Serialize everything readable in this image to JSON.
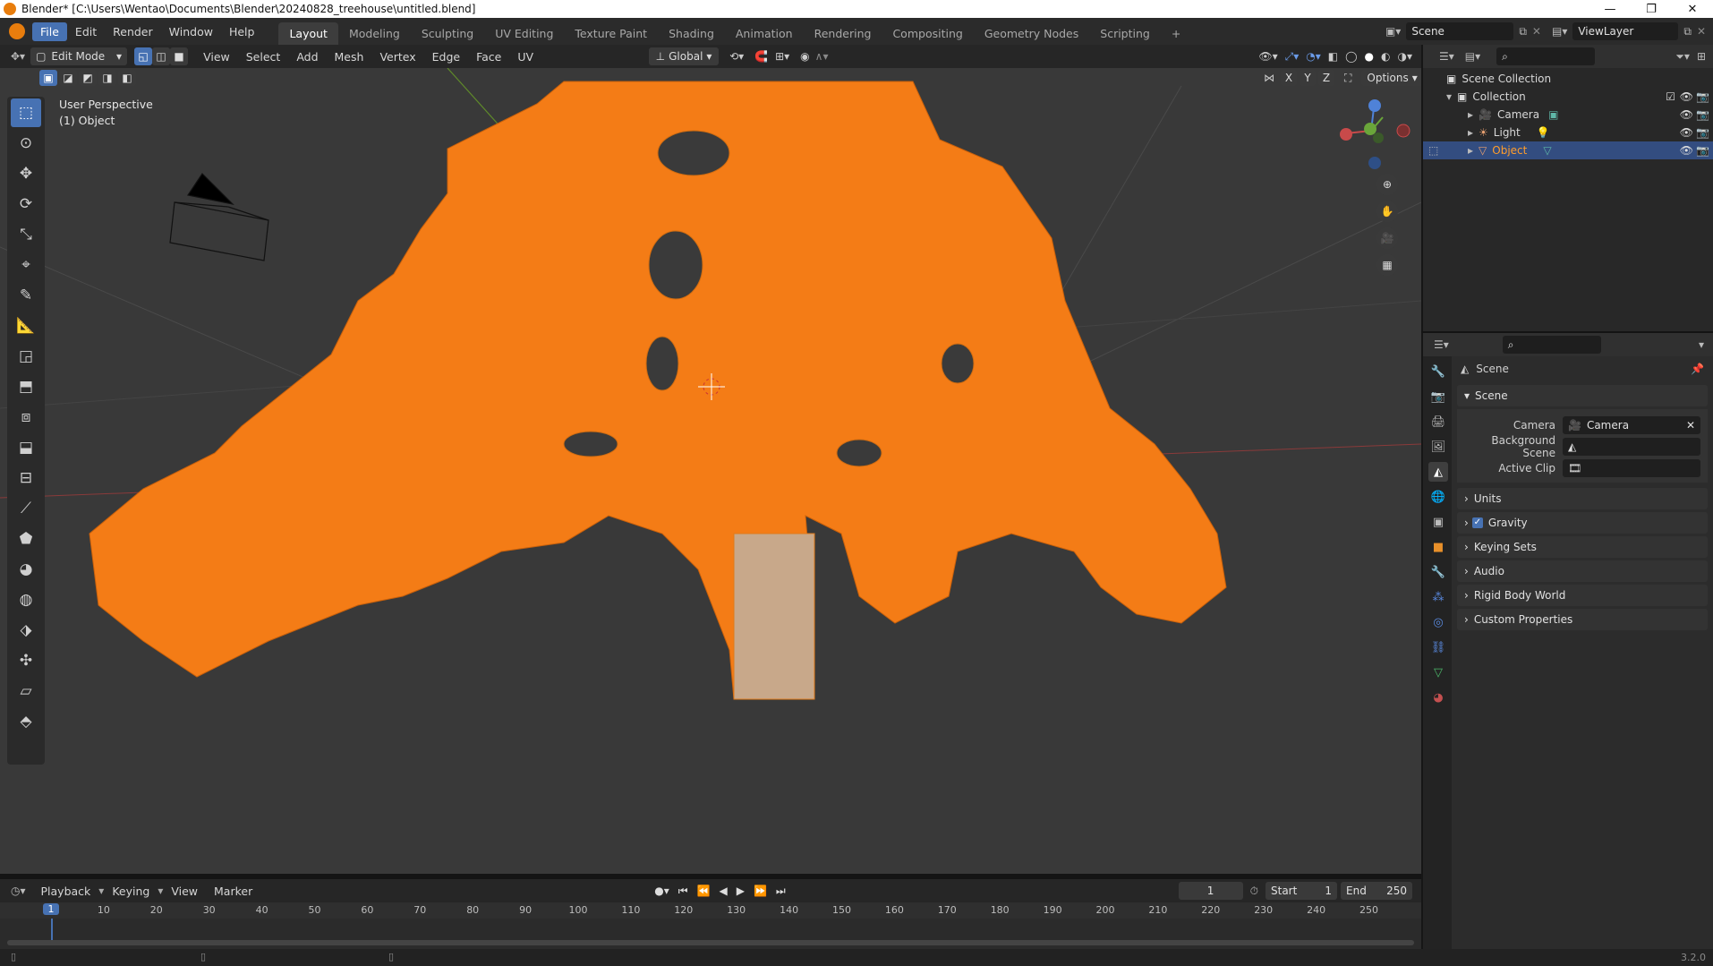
{
  "window": {
    "title": "Blender* [C:\\Users\\Wentao\\Documents\\Blender\\20240828_treehouse\\untitled.blend]",
    "controls": [
      "—",
      "❐",
      "✕"
    ]
  },
  "menu": {
    "items": [
      "File",
      "Edit",
      "Render",
      "Window",
      "Help"
    ],
    "workspaces": [
      "Layout",
      "Modeling",
      "Sculpting",
      "UV Editing",
      "Texture Paint",
      "Shading",
      "Animation",
      "Rendering",
      "Compositing",
      "Geometry Nodes",
      "Scripting"
    ],
    "add_tab": "+",
    "scene_name": "Scene",
    "view_layer": "ViewLayer"
  },
  "viewport_header": {
    "mode": "Edit Mode",
    "menus": [
      "View",
      "Select",
      "Add",
      "Mesh",
      "Vertex",
      "Edge",
      "Face",
      "UV"
    ],
    "transform_orientation": "Global",
    "axes": [
      "X",
      "Y",
      "Z"
    ],
    "options_label": "Options"
  },
  "viewport": {
    "perspective_label": "User Perspective",
    "object_label": "(1) Object",
    "mesh_color": "#f47c16",
    "background_color": "#393939"
  },
  "outliner": {
    "search_placeholder": "",
    "root": "Scene Collection",
    "collection": "Collection",
    "items": [
      {
        "name": "Camera",
        "icon": "camera-icon"
      },
      {
        "name": "Light",
        "icon": "light-icon"
      },
      {
        "name": "Object",
        "icon": "mesh-icon",
        "selected": true
      }
    ]
  },
  "properties": {
    "context_title": "Scene",
    "section": "Scene",
    "fields": [
      {
        "label": "Camera",
        "value": "Camera"
      },
      {
        "label": "Background Scene",
        "value": ""
      },
      {
        "label": "Active Clip",
        "value": ""
      }
    ],
    "panels": [
      "Units",
      "Gravity",
      "Keying Sets",
      "Audio",
      "Rigid Body World",
      "Custom Properties"
    ],
    "gravity_checked": true
  },
  "timeline": {
    "menus": [
      "Playback",
      "Keying",
      "View",
      "Marker"
    ],
    "current_frame": "1",
    "start_label": "Start",
    "start_value": "1",
    "end_label": "End",
    "end_value": "250",
    "ticks": [
      "10",
      "20",
      "30",
      "40",
      "50",
      "60",
      "70",
      "80",
      "90",
      "100",
      "110",
      "120",
      "130",
      "140",
      "150",
      "160",
      "170",
      "180",
      "190",
      "200",
      "210",
      "220",
      "230",
      "240",
      "250"
    ],
    "playhead": "1"
  },
  "status": {
    "version": "3.2.0"
  }
}
